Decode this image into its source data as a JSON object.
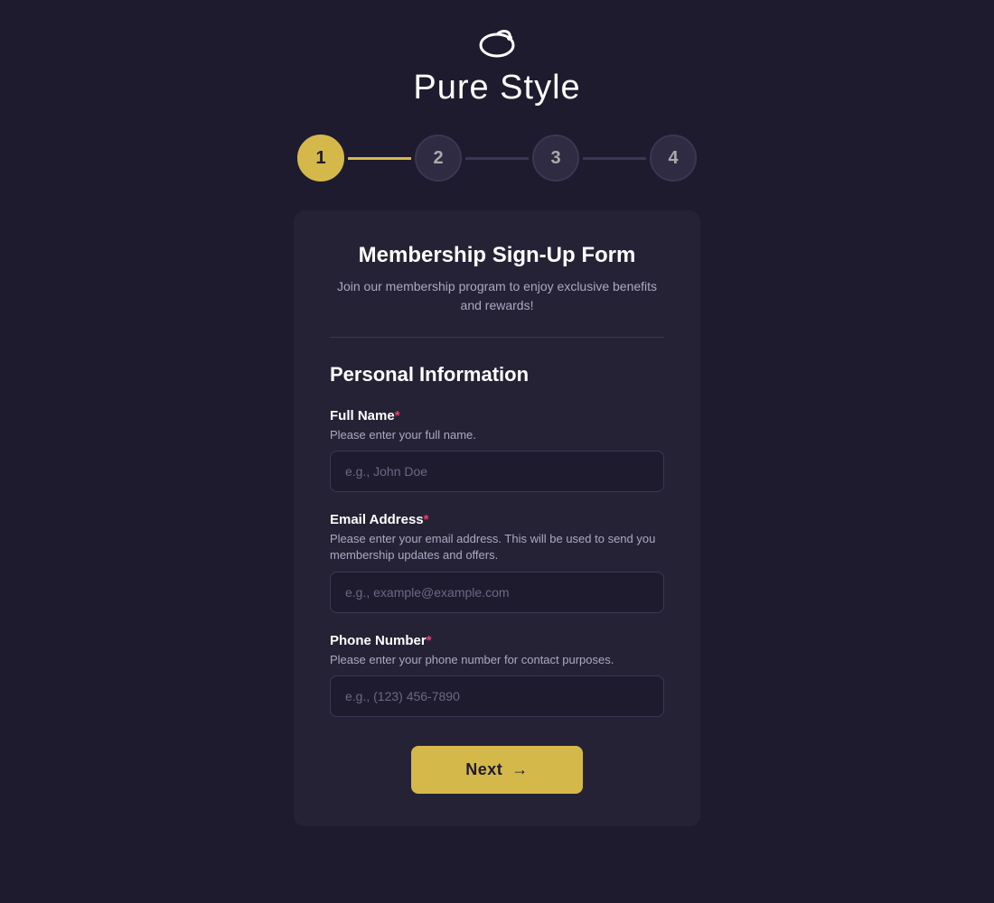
{
  "header": {
    "logo_alt": "Pure Style logo",
    "brand_name": "Pure Style"
  },
  "stepper": {
    "steps": [
      {
        "number": "1",
        "active": true
      },
      {
        "number": "2",
        "active": false
      },
      {
        "number": "3",
        "active": false
      },
      {
        "number": "4",
        "active": false
      }
    ],
    "lines": [
      {
        "active": true
      },
      {
        "active": false
      },
      {
        "active": false
      }
    ]
  },
  "form": {
    "title": "Membership Sign-Up Form",
    "subtitle": "Join our membership program to enjoy exclusive benefits and rewards!",
    "section_title": "Personal Information",
    "fields": [
      {
        "label": "Full Name",
        "required": true,
        "description": "Please enter your full name.",
        "placeholder": "e.g., John Doe",
        "type": "text",
        "name": "full-name"
      },
      {
        "label": "Email Address",
        "required": true,
        "description": "Please enter your email address. This will be used to send you membership updates and offers.",
        "placeholder": "e.g., example@example.com",
        "type": "email",
        "name": "email-address"
      },
      {
        "label": "Phone Number",
        "required": true,
        "description": "Please enter your phone number for contact purposes.",
        "placeholder": "e.g., (123) 456-7890",
        "type": "tel",
        "name": "phone-number"
      }
    ]
  },
  "buttons": {
    "next_label": "Next",
    "next_arrow": "→"
  },
  "colors": {
    "background": "#1e1b2e",
    "card": "#252236",
    "accent": "#d4b84a",
    "required": "#e83e6c"
  }
}
